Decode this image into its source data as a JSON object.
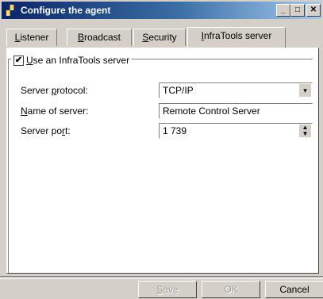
{
  "window": {
    "title": "Configure the agent",
    "title_icon": "agent-config-icon",
    "controls": {
      "minimize": "_",
      "maximize": "□",
      "close": "✕"
    }
  },
  "tabs": [
    {
      "label_u": "L",
      "label_rest": "istener",
      "active": false
    },
    {
      "label_u": "B",
      "label_rest": "roadcast",
      "active": false
    },
    {
      "label_u": "S",
      "label_rest": "ecurity",
      "active": false
    },
    {
      "label_u": "I",
      "label_rest": "nfraTools server",
      "active": true
    }
  ],
  "group": {
    "checkbox_checked": true,
    "checkbox_mark": "✔",
    "checkbox_label_u": "U",
    "checkbox_label_rest": "se an InfraTools server"
  },
  "form": {
    "protocol": {
      "label_pre": "Server ",
      "label_u": "p",
      "label_rest": "rotocol:",
      "value": "TCP/IP"
    },
    "server_name": {
      "label_pre": "",
      "label_u": "N",
      "label_rest": "ame of server:",
      "value": "Remote Control Server"
    },
    "port": {
      "label_pre": "Server po",
      "label_u": "r",
      "label_rest": "t:",
      "value": "1 739"
    }
  },
  "buttons": {
    "save_u": "S",
    "save_rest": "ave",
    "save_enabled": false,
    "ok_label": "OK",
    "ok_enabled": false,
    "cancel_label": "Cancel"
  }
}
